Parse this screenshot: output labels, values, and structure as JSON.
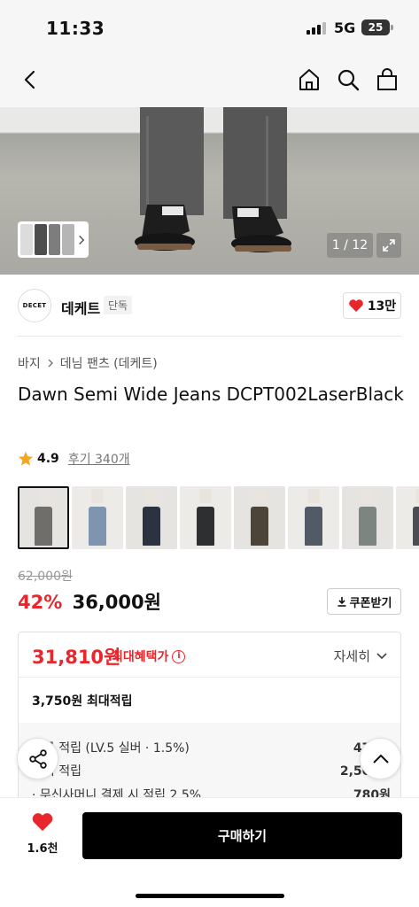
{
  "status_bar": {
    "time": "11:33",
    "network": "5G",
    "battery": "25"
  },
  "nav": {
    "icons": [
      "back-icon",
      "home-icon",
      "search-icon",
      "shopping-bag-icon"
    ]
  },
  "gallery": {
    "counter": "1 / 12"
  },
  "brand": {
    "logo_text": "DECET",
    "name": "데케트",
    "tag": "단독",
    "likes": "13만"
  },
  "breadcrumb": {
    "items": [
      "바지",
      "데님 팬츠 (데케트)"
    ]
  },
  "product": {
    "title": "Dawn Semi Wide Jeans DCPT002LaserBlack",
    "rating": "4.9",
    "review_label": "후기 340개"
  },
  "thumbnails": {
    "colors": [
      "#6f6e6b",
      "#7f94ae",
      "#2c3340",
      "#2e2f31",
      "#4c4439",
      "#525a66",
      "#7c8580",
      "#4a4d52"
    ]
  },
  "price": {
    "original": "62,000원",
    "discount": "42%",
    "sale": "36,000원",
    "coupon_label": "쿠폰받기"
  },
  "benefit": {
    "price": "31,810원",
    "label": "최대혜택가",
    "detail_label": "자세히",
    "max_points": "3,750원 최대적립",
    "rows": [
      {
        "label": "등급 적립 (LV.5 실버 · 1.5%)",
        "amount": "470원"
      },
      {
        "label": "후기 적립",
        "amount": "2,500원"
      },
      {
        "label": "· 무신사머니 결제 시 적립 2.5%",
        "amount": "780원"
      }
    ]
  },
  "bottom": {
    "wish_count": "1.6천",
    "buy_label": "구매하기"
  },
  "colors": {
    "accent_red": "#e8262c",
    "buy_button": "#000000"
  }
}
